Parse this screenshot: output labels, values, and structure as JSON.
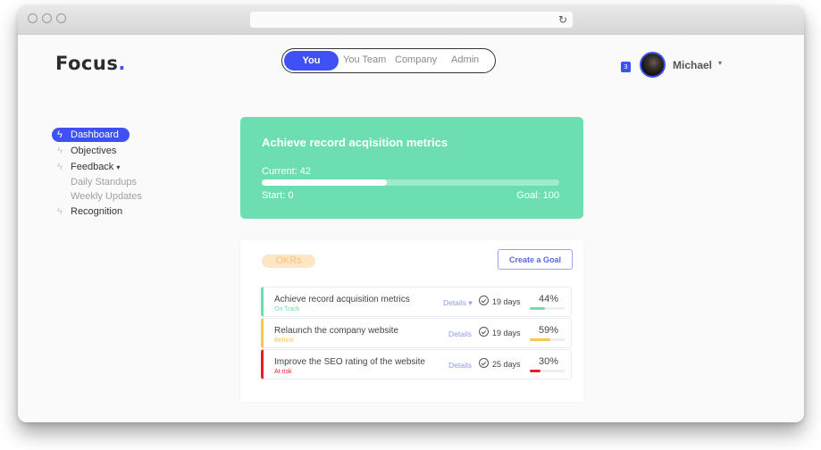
{
  "browser": {
    "reload_icon": "reload-icon"
  },
  "header": {
    "logo": "Focus",
    "logo_dot": ".",
    "nav": [
      {
        "label": "You",
        "active": true
      },
      {
        "label": "You Team",
        "active": false
      },
      {
        "label": "Company",
        "active": false
      },
      {
        "label": "Admin",
        "active": false
      }
    ],
    "notification_count": "3",
    "user_name": "Michael",
    "user_caret": "▾"
  },
  "sidebar": {
    "items": [
      {
        "label": "Dashboard",
        "icon": "bolt-icon",
        "active": true
      },
      {
        "label": "Objectives",
        "icon": "bolt-icon"
      },
      {
        "label": "Feedback",
        "icon": "bolt-icon",
        "caret": "▾"
      },
      {
        "label": "Daily Standups",
        "sub": true
      },
      {
        "label": "Weekly Updates",
        "sub": true
      },
      {
        "label": "Recognition",
        "icon": "bolt-icon"
      }
    ]
  },
  "hero": {
    "title": "Achieve record acqisition metrics",
    "current_label": "Current: 42",
    "start_label": "Start: 0",
    "goal_label": "Goal: 100",
    "progress_percent": 42,
    "color": "#6cdeb2"
  },
  "okrs": {
    "chip_label": "OKRs",
    "create_label": "Create a Goal",
    "rows": [
      {
        "name": "Achieve record acquisition metrics",
        "status": "On Track",
        "status_color": "#6cdeb2",
        "details": "Details ▾",
        "days": "19 days",
        "percent_label": "44%",
        "percent": 44,
        "bar_color": "#6cdeb2"
      },
      {
        "name": "Relaunch the company website",
        "status": "Behind",
        "status_color": "#f7c948",
        "details": "Details",
        "days": "19 days",
        "percent_label": "59%",
        "percent": 59,
        "bar_color": "#f7c948"
      },
      {
        "name": "Improve the SEO rating of the website",
        "status": "At risk",
        "status_color": "#ee1c25",
        "details": "Details",
        "days": "25 days",
        "percent_label": "30%",
        "percent": 30,
        "bar_color": "#ee1c25"
      }
    ]
  },
  "colors": {
    "accent": "#3f51f5",
    "success": "#6cdeb2",
    "warning": "#f7c948",
    "danger": "#ee1c25"
  }
}
